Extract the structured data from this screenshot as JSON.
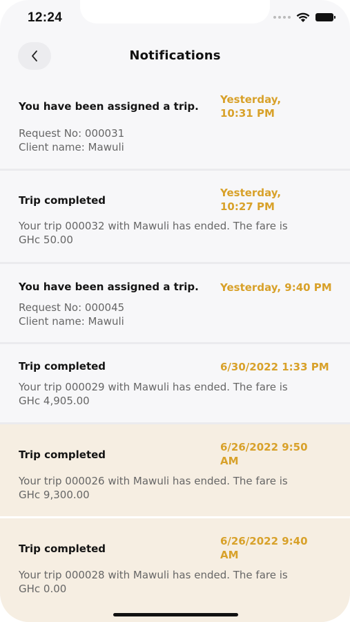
{
  "status_bar": {
    "time": "12:24"
  },
  "header": {
    "title": "Notifications"
  },
  "notifications": [
    {
      "title": "You have been assigned a trip.",
      "timestamp": "Yesterday, 10:31 PM",
      "line1": "Request No: 000031",
      "line2": "Client name: Mawuli",
      "unread": false
    },
    {
      "title": "Trip completed",
      "timestamp": "Yesterday, 10:27 PM",
      "line1": "Your trip 000032 with Mawuli has ended. The fare is",
      "line2": "GHc 50.00",
      "unread": false
    },
    {
      "title": "You have been assigned a trip.",
      "timestamp": "Yesterday, 9:40 PM",
      "line1": "Request No: 000045",
      "line2": "Client name: Mawuli",
      "unread": false
    },
    {
      "title": "Trip completed",
      "timestamp": "6/30/2022 1:33 PM",
      "line1": "Your trip 000029 with Mawuli has ended. The fare is",
      "line2": "GHc 4,905.00",
      "unread": false
    },
    {
      "title": "Trip completed",
      "timestamp": "6/26/2022 9:50 AM",
      "line1": "Your trip 000026 with Mawuli has ended. The fare is",
      "line2": "GHc 9,300.00",
      "unread": true
    },
    {
      "title": "Trip completed",
      "timestamp": "6/26/2022 9:40 AM",
      "line1": "Your trip 000028 with Mawuli has ended. The fare is",
      "line2": "GHc 0.00",
      "unread": true
    }
  ],
  "colors": {
    "accent": "#d8a12a",
    "unread_bg": "#f6eee2",
    "background": "#f7f7f9"
  },
  "icons": [
    "back-chevron-icon",
    "wifi-icon",
    "battery-icon",
    "cellular-signal-icon"
  ]
}
